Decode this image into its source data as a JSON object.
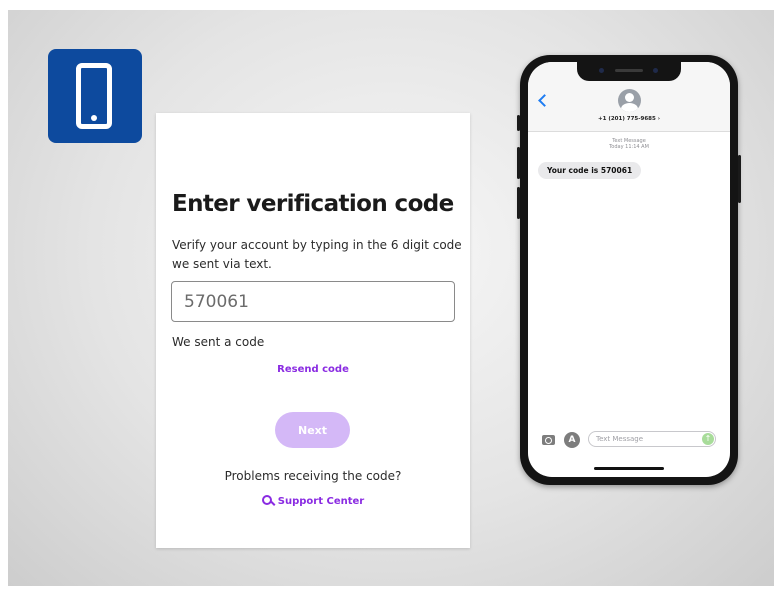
{
  "badge": {
    "icon": "mobile-phone-icon",
    "color": "#0d4a9e"
  },
  "card": {
    "title": "Enter verification code",
    "description": "Verify your account by typing in the 6 digit code we sent via text.",
    "code_value": "570061",
    "sent_text": "We sent a code",
    "resend_label": "Resend code",
    "next_label": "Next",
    "problems_text": "Problems receiving the code?",
    "support_label": "Support Center",
    "accent_color": "#8a2be2"
  },
  "phone": {
    "contact_number": "+1 (201) 775-9685 ›",
    "meta_line1": "Text Message",
    "meta_line2": "Today 11:14 AM",
    "message": "Your code is 570061",
    "compose_placeholder": "Text Message",
    "appstore_glyph": "A",
    "send_glyph": "↑"
  }
}
